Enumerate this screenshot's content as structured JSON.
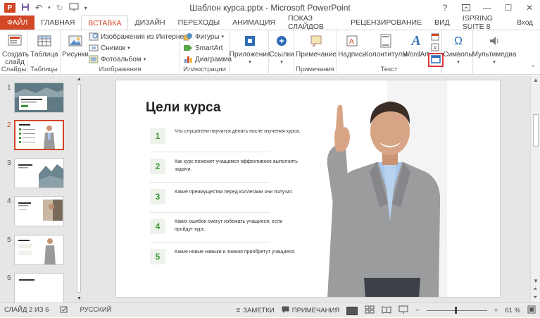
{
  "app": {
    "window_title": "Шаблон курса.pptx - Microsoft PowerPoint",
    "logo_letter": "P",
    "login": "Вход"
  },
  "tabs": [
    "ФАЙЛ",
    "ГЛАВНАЯ",
    "ВСТАВКА",
    "ДИЗАЙН",
    "ПЕРЕХОДЫ",
    "АНИМАЦИЯ",
    "ПОКАЗ СЛАЙДОВ",
    "РЕЦЕНЗИРОВАНИЕ",
    "ВИД",
    "ISPRING SUITE 8"
  ],
  "active_tab": "ВСТАВКА",
  "ribbon": {
    "groups": {
      "slides": "Слайды",
      "tables": "Таблицы",
      "images": "Изображения",
      "illustrations": "Иллюстрации",
      "notes": "Примечания",
      "text": "Текст"
    },
    "buttons": {
      "new_slide": "Создать слайд",
      "table": "Таблица",
      "pictures": "Рисунки",
      "online_pictures": "Изображения из Интернета",
      "screenshot": "Снимок",
      "photo_album": "Фотоальбом",
      "shapes": "Фигуры",
      "smartart": "SmartArt",
      "chart": "Диаграмма",
      "apps": "Приложения",
      "links": "Ссылки",
      "comment": "Примечание",
      "textbox": "Надпись",
      "header_footer": "Колонтитулы",
      "wordart": "WordArt",
      "symbols": "Символы",
      "media": "Мультимедиа"
    }
  },
  "slides_pane": {
    "numbers": [
      "1",
      "2",
      "3",
      "4",
      "5",
      "6"
    ],
    "active_index": 2,
    "thumb_titles": [
      "",
      "Цели курса",
      "Введение в тему",
      "Основы курса",
      "Ключевые идеи",
      "Спасибо за участие"
    ]
  },
  "slide": {
    "title": "Цели курса",
    "goals": [
      {
        "num": "1",
        "text": "Что слушатели научатся делать после изучения курса."
      },
      {
        "num": "2",
        "text": "Как курс поможет учащимся эффективнее выполнять задачи."
      },
      {
        "num": "3",
        "text": "Какие преимущества перед коллегами они получат."
      },
      {
        "num": "4",
        "text": "Каких ошибок смогут избежать учащиеся, если пройдут курс."
      },
      {
        "num": "5",
        "text": "Какие новые навыки и знания приобретут учащиеся."
      }
    ]
  },
  "status": {
    "slide_counter": "СЛАЙД 2 ИЗ 6",
    "language": "РУССКИЙ",
    "notes": "ЗАМЕТКИ",
    "comments": "ПРИМЕЧАНИЯ",
    "zoom_percent": "61 %",
    "zoom_level": 0.61
  },
  "colors": {
    "accent": "#d24726",
    "goal_green": "#3f9a38",
    "highlight_box": "#e03a3a"
  }
}
